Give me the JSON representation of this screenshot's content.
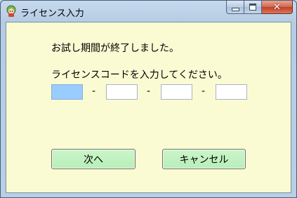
{
  "window": {
    "title": "ライセンス入力",
    "icon": "character-icon",
    "controls": {
      "minimize": "minimize-icon",
      "maximize": "maximize-icon",
      "close": "close-icon"
    }
  },
  "dialog": {
    "message_expired": "お試し期間が終了しました。",
    "message_prompt": "ライセンスコードを入力してください。",
    "license_fields": [
      {
        "value": ""
      },
      {
        "value": ""
      },
      {
        "value": ""
      },
      {
        "value": ""
      }
    ],
    "separator": "-",
    "next_label": "次へ",
    "cancel_label": "キャンセル"
  },
  "colors": {
    "client_background": "#fbfbd3",
    "button_background": "#c4f2c4",
    "active_field": "#99ccff"
  }
}
